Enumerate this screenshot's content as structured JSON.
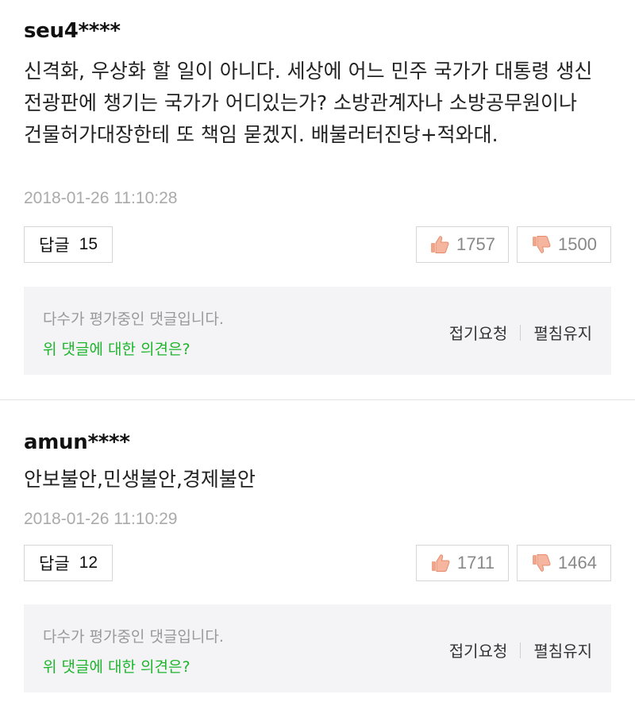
{
  "comments": [
    {
      "username": "seu4****",
      "text": "신격화, 우상화 할 일이 아니다. 세상에 어느 민주 국가가 대통령 생신 전광판에 챙기는 국가가 어디있는가? 소방관계자나 소방공무원이나 건물허가대장한테 또 책임 묻겠지. 배불러터진당+적와대.",
      "date": "2018-01-26 11:10:28",
      "reply_label": "답글",
      "reply_count": "15",
      "likes": "1757",
      "dislikes": "1500",
      "eval_notice": "다수가 평가중인 댓글입니다.",
      "eval_question": "위 댓글에 대한 의견은?",
      "fold_request": "접기요청",
      "keep_open": "펼침유지"
    },
    {
      "username": "amun****",
      "text": "안보불안,민생불안,경제불안",
      "date": "2018-01-26 11:10:29",
      "reply_label": "답글",
      "reply_count": "12",
      "likes": "1711",
      "dislikes": "1464",
      "eval_notice": "다수가 평가중인 댓글입니다.",
      "eval_question": "위 댓글에 대한 의견은?",
      "fold_request": "접기요청",
      "keep_open": "펼침유지"
    }
  ],
  "colors": {
    "accent_green": "#1eb52d",
    "thumb_up": "#e9967a",
    "thumb_down": "#e9967a"
  }
}
